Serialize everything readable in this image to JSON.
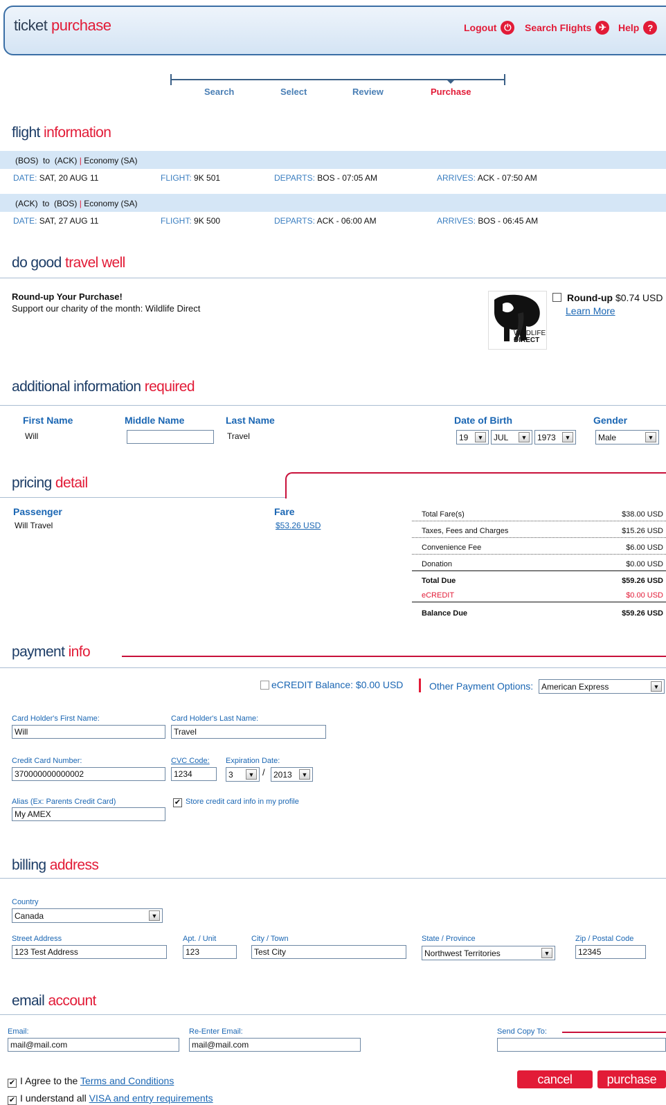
{
  "header": {
    "title_a": "ticket",
    "title_b": "purchase",
    "logout": "Logout",
    "search_flights": "Search Flights",
    "help": "Help"
  },
  "steps": [
    "Search",
    "Select",
    "Review",
    "Purchase"
  ],
  "flight": {
    "title_a": "flight",
    "title_b": "information",
    "legs": [
      {
        "route_from": "(BOS)",
        "route_to": "(ACK)",
        "to_word": "to",
        "cabin": "Economy (SA)",
        "date_label": "DATE:",
        "date": "SAT, 20 AUG 11",
        "flight_label": "FLIGHT:",
        "flight": "9K 501",
        "departs_label": "DEPARTS:",
        "departs": "BOS - 07:05 AM",
        "arrives_label": "ARRIVES:",
        "arrives": "ACK - 07:50 AM"
      },
      {
        "route_from": "(ACK)",
        "route_to": "(BOS)",
        "to_word": "to",
        "cabin": "Economy (SA)",
        "date_label": "DATE:",
        "date": "SAT, 27 AUG 11",
        "flight_label": "FLIGHT:",
        "flight": "9K 500",
        "departs_label": "DEPARTS:",
        "departs": "ACK - 06:00 AM",
        "arrives_label": "ARRIVES:",
        "arrives": "BOS - 06:45 AM"
      }
    ]
  },
  "charity": {
    "title_a": "do good",
    "title_b": "travel well",
    "heading": "Round-up Your Purchase!",
    "text": "Support our charity of the month: Wildlife Direct",
    "logo_line1": "WILDLIFE",
    "logo_line2": "DIRECT",
    "roundup_label": "Round-up",
    "roundup_amount": "$0.74 USD",
    "learn_more": "Learn More"
  },
  "additional": {
    "title_a": "additional information",
    "title_b": "required",
    "first_name_label": "First Name",
    "middle_name_label": "Middle Name",
    "last_name_label": "Last Name",
    "dob_label": "Date of Birth",
    "gender_label": "Gender",
    "first_name": "Will",
    "middle_name": "",
    "last_name": "Travel",
    "dob_day": "19",
    "dob_month": "JUL",
    "dob_year": "1973",
    "gender": "Male"
  },
  "pricing": {
    "title_a": "pricing",
    "title_b": "detail",
    "passenger_label": "Passenger",
    "passenger": "Will Travel",
    "fare_label": "Fare",
    "fare": "$53.26 USD",
    "rows": [
      {
        "label": "Total Fare(s)",
        "value": "$38.00 USD"
      },
      {
        "label": "Taxes, Fees and Charges",
        "value": "$15.26 USD"
      },
      {
        "label": "Convenience Fee",
        "value": "$6.00 USD"
      },
      {
        "label": "Donation",
        "value": "$0.00 USD"
      },
      {
        "label": "Total Due",
        "value": "$59.26 USD"
      },
      {
        "label": "eCREDIT",
        "value": "$0.00 USD"
      },
      {
        "label": "Balance Due",
        "value": "$59.26 USD"
      }
    ]
  },
  "payment": {
    "title_a": "payment",
    "title_b": "info",
    "ecredit_balance": "eCREDIT Balance: $0.00 USD",
    "other_options_label": "Other Payment Options:",
    "other_options_value": "American Express",
    "holder_first_label": "Card Holder's First Name:",
    "holder_first": "Will",
    "holder_last_label": "Card Holder's Last Name:",
    "holder_last": "Travel",
    "card_number_label": "Credit Card Number:",
    "card_number": "370000000000002",
    "cvc_label": "CVC Code:",
    "cvc": "1234",
    "exp_label": "Expiration Date:",
    "exp_month": "3",
    "exp_year": "2013",
    "exp_sep": "/",
    "alias_label": "Alias (Ex: Parents Credit Card)",
    "alias": "My AMEX",
    "store_label": "Store credit card info in my profile"
  },
  "billing": {
    "title_a": "billing",
    "title_b": "address",
    "country_label": "Country",
    "country": "Canada",
    "street_label": "Street Address",
    "street": "123 Test Address",
    "apt_label": "Apt. / Unit",
    "apt": "123",
    "city_label": "City / Town",
    "city": "Test City",
    "state_label": "State / Province",
    "state": "Northwest Territories",
    "zip_label": "Zip / Postal Code",
    "zip": "12345"
  },
  "email": {
    "title_a": "email",
    "title_b": "account",
    "email_label": "Email:",
    "email": "mail@mail.com",
    "reenter_label": "Re-Enter Email:",
    "reenter": "mail@mail.com",
    "copy_label": "Send Copy To:",
    "copy": ""
  },
  "footer": {
    "agree_prefix": "I Agree to the",
    "agree_link": "Terms and Conditions",
    "visa_prefix": "I understand all",
    "visa_link": "VISA and entry requirements",
    "cancel": "cancel",
    "purchase": "purchase"
  }
}
